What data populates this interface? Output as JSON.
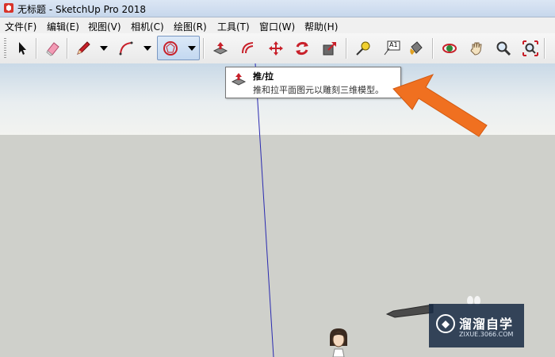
{
  "window": {
    "title": "无标题 - SketchUp Pro 2018"
  },
  "menu": {
    "items": [
      "文件(F)",
      "编辑(E)",
      "视图(V)",
      "相机(C)",
      "绘图(R)",
      "工具(T)",
      "窗口(W)",
      "帮助(H)"
    ]
  },
  "toolbar": {
    "tools": [
      {
        "name": "select-tool",
        "icon": "arrow-cursor-icon"
      },
      {
        "name": "eraser-tool",
        "icon": "eraser-icon"
      },
      {
        "name": "line-tool",
        "icon": "pencil-icon"
      },
      {
        "name": "arc-tool",
        "icon": "arc-icon"
      },
      {
        "name": "shape-tool",
        "icon": "polygon-icon"
      },
      {
        "name": "push-pull-tool",
        "icon": "push-pull-icon"
      },
      {
        "name": "offset-tool",
        "icon": "offset-icon"
      },
      {
        "name": "move-tool",
        "icon": "move-icon"
      },
      {
        "name": "rotate-tool",
        "icon": "rotate-icon"
      },
      {
        "name": "scale-tool",
        "icon": "scale-icon"
      },
      {
        "name": "tape-measure-tool",
        "icon": "tape-measure-icon"
      },
      {
        "name": "text-tool",
        "icon": "text-icon"
      },
      {
        "name": "paint-bucket-tool",
        "icon": "paint-bucket-icon"
      },
      {
        "name": "orbit-tool",
        "icon": "orbit-icon"
      },
      {
        "name": "pan-tool",
        "icon": "hand-icon"
      },
      {
        "name": "zoom-tool",
        "icon": "magnifier-icon"
      },
      {
        "name": "zoom-extents-tool",
        "icon": "zoom-extents-icon"
      }
    ],
    "text_tool_label": "A1"
  },
  "tooltip": {
    "title": "推/拉",
    "description": "推和拉平面图元以雕刻三维模型。"
  },
  "watermark": {
    "title": "溜溜自学",
    "subtitle": "ZIXUE.3066.COM"
  },
  "colors": {
    "accent_arrow": "#f07020",
    "axis_blue": "#2a2ab0",
    "sky_top": "#c9d9e7",
    "ground": "#cfd0cb",
    "watermark_bg": "#182a44"
  }
}
